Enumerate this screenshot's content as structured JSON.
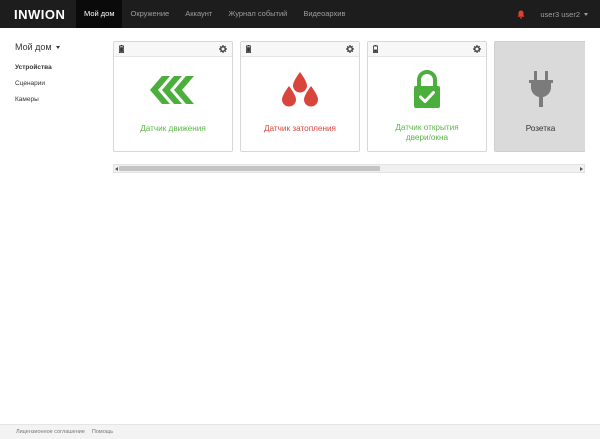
{
  "navbar": {
    "brand": "INWION",
    "items": [
      {
        "label": "Мой дом",
        "active": true
      },
      {
        "label": "Окружение",
        "active": false
      },
      {
        "label": "Аккаунт",
        "active": false
      },
      {
        "label": "Журнал событий",
        "active": false
      },
      {
        "label": "Видеоархив",
        "active": false
      }
    ],
    "user": "user3 user2",
    "bell_icon": "bell-icon",
    "bell_color": "#e0402f"
  },
  "sidebar": {
    "title": "Мой дом",
    "items": [
      {
        "label": "Устройства",
        "active": true
      },
      {
        "label": "Сценарии",
        "active": false
      },
      {
        "label": "Камеры",
        "active": false
      }
    ]
  },
  "cards": [
    {
      "label": "Датчик движения",
      "icon": "motion-chevrons-icon",
      "color": "#4cae3c",
      "header": true
    },
    {
      "label": "Датчик затопления",
      "icon": "water-drops-icon",
      "color": "#d9453d",
      "header": true
    },
    {
      "label_line1": "Датчик открытия",
      "label_line2": "двери/окна",
      "icon": "padlock-check-icon",
      "color": "#4cae3c",
      "header": true
    },
    {
      "label": "Розетка",
      "icon": "power-plug-icon",
      "color": "#7b7b7b",
      "header": false
    }
  ],
  "footer": {
    "links": [
      "Лицензионное соглашение",
      "Помощь"
    ]
  }
}
